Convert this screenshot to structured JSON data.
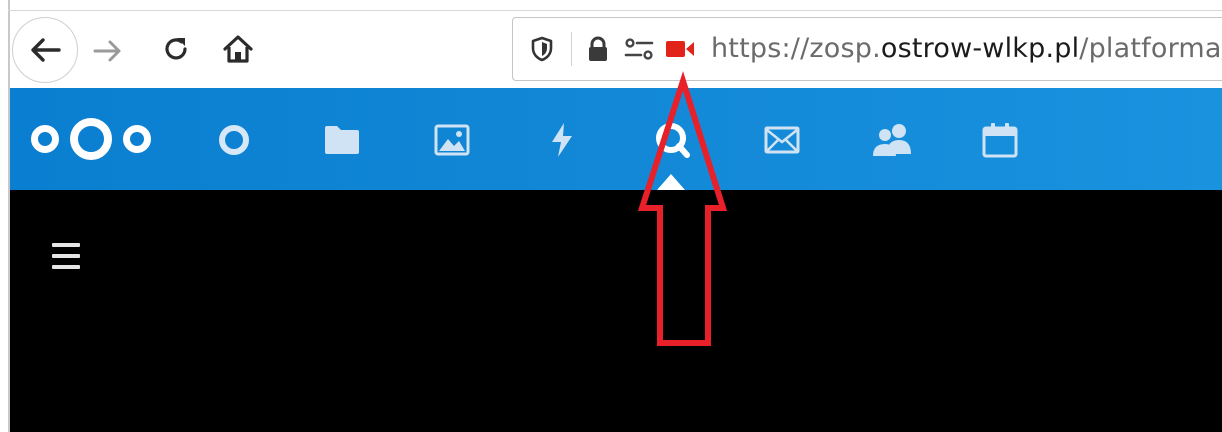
{
  "browser": {
    "nav": {
      "back_icon": "arrow-left-icon",
      "forward_icon": "arrow-right-icon",
      "reload_icon": "reload-icon",
      "home_icon": "home-icon"
    },
    "urlbar": {
      "url_prefix": "https://zosp.",
      "url_host": "ostrow-wlkp.pl",
      "url_path": "/platforma/in",
      "icons": [
        "tracking-shield-icon",
        "lock-icon",
        "permissions-icon",
        "camera-in-use-icon"
      ]
    }
  },
  "nextcloud": {
    "logo_icon": "nextcloud-logo-icon",
    "apps": [
      "dashboard-icon",
      "files-icon",
      "photos-icon",
      "activity-icon",
      "talk-icon",
      "mail-icon",
      "contacts-icon",
      "calendar-icon"
    ],
    "active_app": "talk-icon"
  },
  "content": {
    "menu_icon": "hamburger-menu-icon"
  },
  "annotation": {
    "type": "arrow",
    "color": "#e8202a",
    "points_to": "camera-in-use-icon"
  },
  "colors": {
    "header_blue": "#0f85d4",
    "camera_red": "#e2231a",
    "content_bg": "#000000"
  }
}
